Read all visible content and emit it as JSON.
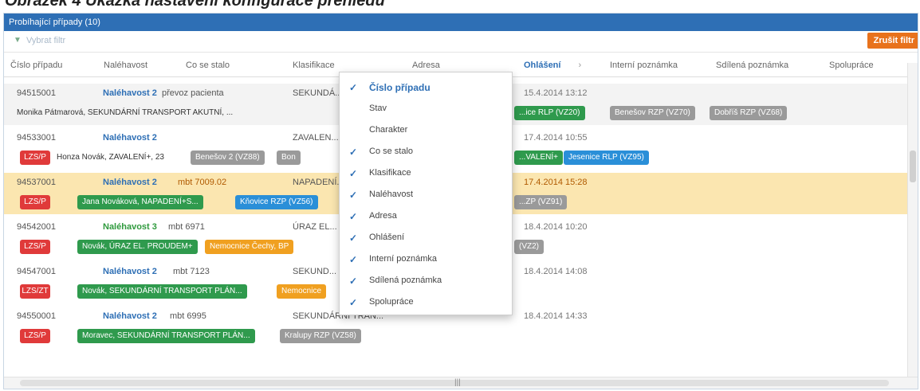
{
  "caption": "Obrázek 4 Ukázka nastavení konfigurace přehledu",
  "panel": {
    "title": "Probíhající případy (10)"
  },
  "filter": {
    "label": "Vybrat filtr",
    "cancel": "Zrušit filtr"
  },
  "columns": [
    {
      "label": "Číslo případu"
    },
    {
      "label": "Naléhavost"
    },
    {
      "label": "Co se stalo"
    },
    {
      "label": "Klasifikace"
    },
    {
      "label": "Adresa"
    },
    {
      "label": "Ohlášení"
    },
    {
      "label": "Interní poznámka"
    },
    {
      "label": "Sdílená poznámka"
    },
    {
      "label": "Spolupráce"
    }
  ],
  "rows": [
    {
      "id": "94515001",
      "urgency": "Naléhavost 2",
      "what": "převoz pacienta",
      "klas": "SEKUNDÁ...",
      "time": "15.4.2014 13:12",
      "badges": [
        {
          "t": "Monika Pátmarová, SEKUNDÁRNÍ TRANSPORT AKUTNÍ, ...",
          "c": "b-text"
        },
        {
          "t": "...ice RLP (VZ20)",
          "c": "b-green"
        },
        {
          "t": "Benešov RZP (VZ70)",
          "c": "b-gray"
        },
        {
          "t": "Dobříš RZP (VZ68)",
          "c": "b-gray"
        }
      ]
    },
    {
      "id": "94533001",
      "urgency": "Naléhavost 2",
      "what": "",
      "klas": "ZAVALEN...",
      "time": "17.4.2014 10:55",
      "badges": [
        {
          "t": "LZS/P",
          "c": "b-red"
        },
        {
          "t": "Honza Novák, ZAVALENÍ+, 23",
          "c": "b-text"
        },
        {
          "t": "Benešov 2 (VZ88)",
          "c": "b-gray"
        },
        {
          "t": "Bon",
          "c": "b-gray"
        },
        {
          "t": "...VALENÍ+",
          "c": "b-green"
        },
        {
          "t": "Jesenice RLP (VZ95)",
          "c": "b-blue"
        }
      ]
    },
    {
      "id": "94537001",
      "urgency": "Naléhavost 2",
      "what": "mbt 7009.02",
      "klas": "NAPADENÍ...",
      "time": "17.4.2014 15:28",
      "badges": [
        {
          "t": "LZS/P",
          "c": "b-red"
        },
        {
          "t": "Jana Nováková, NAPADENÍ+S...",
          "c": "b-green"
        },
        {
          "t": "Kňovice RZP (VZ56)",
          "c": "b-blue"
        },
        {
          "t": "...ZP (VZ91)",
          "c": "b-gray"
        }
      ]
    },
    {
      "id": "94542001",
      "urgency": "Naléhavost 3",
      "what": "mbt 6971",
      "klas": "ÚRAZ EL...",
      "time": "18.4.2014 10:20",
      "badges": [
        {
          "t": "LZS/P",
          "c": "b-red"
        },
        {
          "t": "Novák, ÚRAZ EL. PROUDEM+",
          "c": "b-green"
        },
        {
          "t": "Nemocnice Čechy, BP",
          "c": "b-orange"
        },
        {
          "t": "(VZ2)",
          "c": "b-gray"
        }
      ]
    },
    {
      "id": "94547001",
      "urgency": "Naléhavost 2",
      "what": "mbt 7123",
      "klas": "SEKUND...",
      "time": "18.4.2014 14:08",
      "badges": [
        {
          "t": "LZS/ZT",
          "c": "b-red"
        },
        {
          "t": "Novák, SEKUNDÁRNÍ TRANSPORT PLÁN...",
          "c": "b-green"
        },
        {
          "t": "Nemocnice",
          "c": "b-orange"
        }
      ]
    },
    {
      "id": "94550001",
      "urgency": "Naléhavost 2",
      "what": "mbt 6995",
      "klas": "SEKUNDÁRNÍ TRAN...",
      "time": "18.4.2014 14:33",
      "badges": [
        {
          "t": "LZS/P",
          "c": "b-red"
        },
        {
          "t": "Moravec, SEKUNDÁRNÍ TRANSPORT PLÁN...",
          "c": "b-green"
        },
        {
          "t": "Kralupy RZP (VZ58)",
          "c": "b-gray"
        }
      ]
    }
  ],
  "menu": {
    "items": [
      {
        "label": "Číslo případu",
        "checked": "✓"
      },
      {
        "label": "Stav",
        "checked": ""
      },
      {
        "label": "Charakter",
        "checked": ""
      },
      {
        "label": "Co se stalo",
        "checked": "✓"
      },
      {
        "label": "Klasifikace",
        "checked": "✓"
      },
      {
        "label": "Naléhavost",
        "checked": "✓"
      },
      {
        "label": "Adresa",
        "checked": "✓"
      },
      {
        "label": "Ohlášení",
        "checked": "✓"
      },
      {
        "label": "Interní poznámka",
        "checked": "✓"
      },
      {
        "label": "Sdílená poznámka",
        "checked": "✓"
      },
      {
        "label": "Spolupráce",
        "checked": "✓"
      }
    ]
  },
  "colors": {
    "header": "#2e6fb5",
    "highlight_row": "#fbe6b0",
    "cancel": "#e8721c"
  }
}
